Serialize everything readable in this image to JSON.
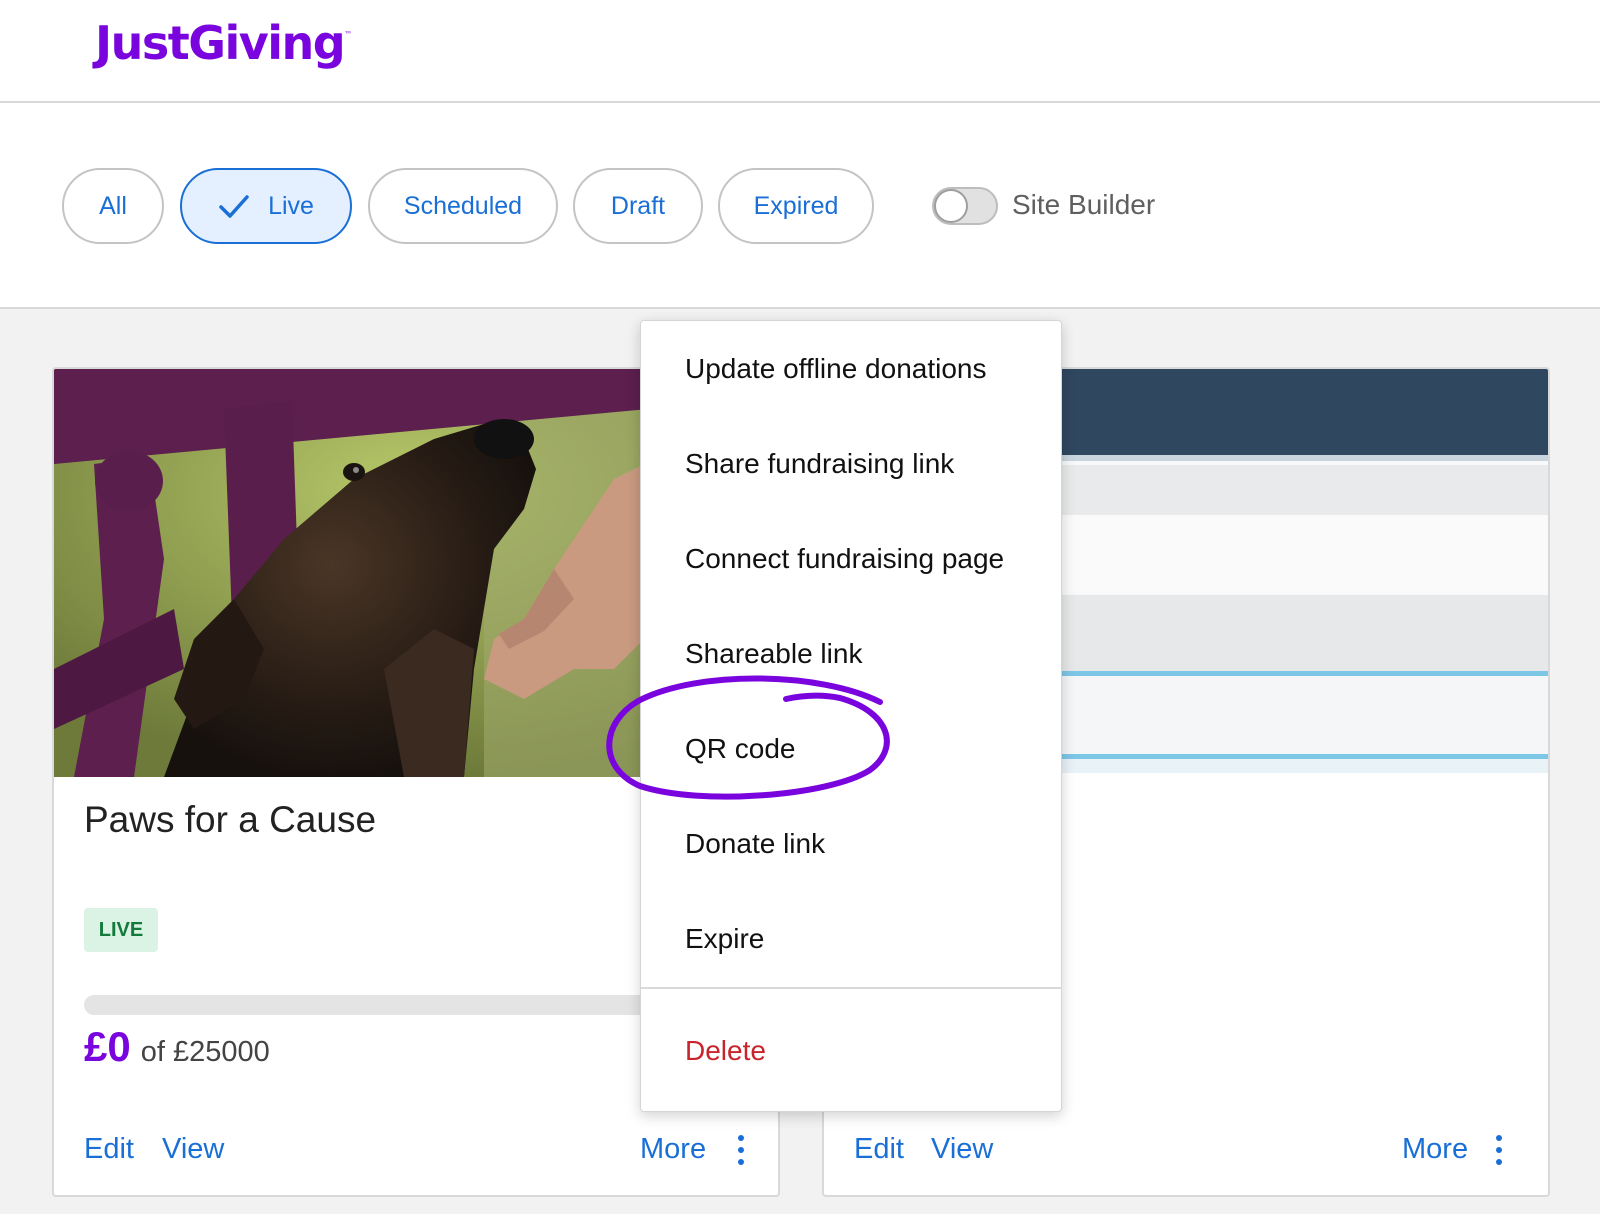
{
  "brand": {
    "name": "JustGiving",
    "trademark": "™",
    "color": "#7a04dd"
  },
  "filters": {
    "chips": [
      {
        "label": "All",
        "active": false
      },
      {
        "label": "Live",
        "active": true
      },
      {
        "label": "Scheduled",
        "active": false
      },
      {
        "label": "Draft",
        "active": false
      },
      {
        "label": "Expired",
        "active": false
      }
    ],
    "site_builder": {
      "label": "Site Builder",
      "enabled": false
    }
  },
  "cards": [
    {
      "title": "Paws for a Cause",
      "status": "LIVE",
      "raised": "£0",
      "target": "of £25000",
      "progress_fraction": 0,
      "actions": {
        "edit": "Edit",
        "view": "View",
        "more": "More"
      }
    },
    {
      "actions": {
        "edit": "Edit",
        "view": "View",
        "more": "More"
      }
    }
  ],
  "menu": {
    "items": [
      "Update offline donations",
      "Share fundraising link",
      "Connect fundraising page",
      "Shareable link",
      "QR code",
      "Donate link",
      "Expire"
    ],
    "delete_label": "Delete",
    "highlighted": "QR code"
  },
  "colors": {
    "link_blue": "#1a6fd6",
    "delete_red": "#c9242c",
    "live_badge_bg": "#dbf3e4",
    "live_badge_text": "#147a3c",
    "annotation_purple": "#7a04dd"
  }
}
